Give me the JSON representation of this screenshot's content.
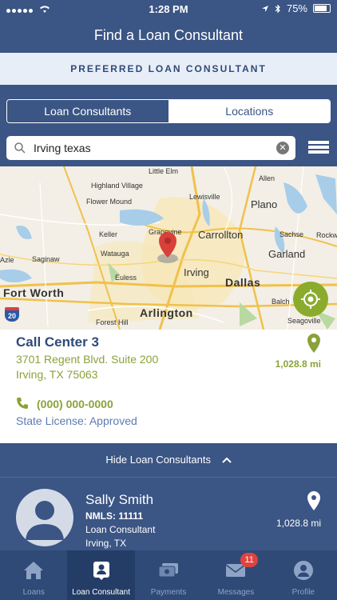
{
  "status": {
    "time": "1:28 PM",
    "battery": "75%"
  },
  "header": {
    "title": "Find a Loan Consultant"
  },
  "preferred": {
    "label": "PREFERRED LOAN CONSULTANT"
  },
  "tabs": {
    "consultants": "Loan Consultants",
    "locations": "Locations",
    "selected": "consultants"
  },
  "search": {
    "value": "Irving texas",
    "placeholder": "Search"
  },
  "map": {
    "labels": [
      "Little Elm",
      "Allen",
      "Highland Village",
      "Lewisville",
      "Flower Mound",
      "Plano",
      "Carrollton",
      "Keller",
      "Grapevine",
      "Sachse",
      "Rockw",
      "Watauga",
      "Garland",
      "Azle",
      "Saginaw",
      "Euless",
      "Irving",
      "Dallas",
      "Fort Worth",
      "Balch",
      "Arlington",
      "Forest Hill",
      "Seagoville",
      "20"
    ]
  },
  "location": {
    "name": "Call Center 3",
    "address_line1": "3701 Regent Blvd. Suite 200",
    "address_line2": "Irving, TX 75063",
    "phone": "(000) 000-0000",
    "license": "State License: Approved",
    "distance": "1,028.8 mi"
  },
  "toggle": {
    "label": "Hide Loan Consultants"
  },
  "consultant": {
    "name": "Sally Smith",
    "nmls": "NMLS: 11111",
    "role": "Loan Consultant",
    "city": "Irving, TX",
    "distance": "1,028.8 mi"
  },
  "tabbar": {
    "items": [
      {
        "label": "Loans",
        "icon": "home-icon"
      },
      {
        "label": "Loan Consultant",
        "icon": "consultant-icon"
      },
      {
        "label": "Payments",
        "icon": "payments-icon"
      },
      {
        "label": "Messages",
        "icon": "mail-icon"
      },
      {
        "label": "Profile",
        "icon": "profile-icon"
      }
    ],
    "active": "Loan Consultant",
    "messages_badge": "11"
  },
  "colors": {
    "primary": "#3b5584",
    "accent_green": "#8ba23a",
    "pin_red": "#d9403a",
    "badge_red": "#e0433e"
  }
}
